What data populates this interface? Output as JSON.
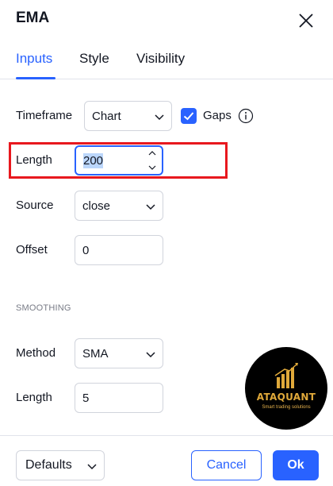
{
  "dialog": {
    "title": "EMA",
    "tabs": [
      {
        "label": "Inputs",
        "active": true
      },
      {
        "label": "Style",
        "active": false
      },
      {
        "label": "Visibility",
        "active": false
      }
    ]
  },
  "inputs": {
    "timeframe": {
      "label": "Timeframe",
      "value": "Chart"
    },
    "gaps": {
      "label": "Gaps",
      "checked": true
    },
    "length": {
      "label": "Length",
      "value": "200"
    },
    "source": {
      "label": "Source",
      "value": "close"
    },
    "offset": {
      "label": "Offset",
      "value": "0"
    }
  },
  "smoothing": {
    "section_label": "SMOOTHING",
    "method": {
      "label": "Method",
      "value": "SMA"
    },
    "length": {
      "label": "Length",
      "value": "5"
    }
  },
  "footer": {
    "defaults_label": "Defaults",
    "cancel_label": "Cancel",
    "ok_label": "Ok"
  },
  "watermark": {
    "name": "ATAQUANT",
    "tagline": "Smart trading solutions"
  },
  "colors": {
    "accent": "#2962ff",
    "highlight": "#e8181e",
    "logo_gold": "#e0a93a"
  }
}
